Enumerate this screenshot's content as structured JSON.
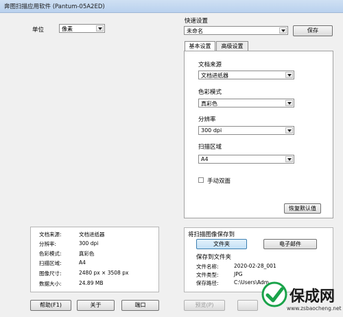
{
  "window": {
    "title": "奔图扫描应用软件 (Pantum-05A2ED)"
  },
  "unit": {
    "label": "单位",
    "value": "像素"
  },
  "quick_settings": {
    "label": "快速设置",
    "value": "未命名",
    "save_label": "保存"
  },
  "tabs": [
    {
      "label": "基本设置",
      "active": true
    },
    {
      "label": "高级设置",
      "active": false
    }
  ],
  "basic": {
    "doc_source": {
      "label": "文档来源",
      "value": "文档进纸器"
    },
    "color_mode": {
      "label": "色彩模式",
      "value": "真彩色"
    },
    "resolution": {
      "label": "分辨率",
      "value": "300 dpi"
    },
    "scan_area": {
      "label": "扫描区域",
      "value": "A4"
    },
    "duplex": {
      "label": "手动双面",
      "checked": false
    },
    "reset_label": "恢复默认值"
  },
  "summary": [
    {
      "key": "文档来源:",
      "value": "文档进纸器"
    },
    {
      "key": "分辨率:",
      "value": "300 dpi"
    },
    {
      "key": "色彩模式:",
      "value": "真彩色"
    },
    {
      "key": "扫描区域:",
      "value": "A4"
    },
    {
      "key": "图像尺寸:",
      "value": "2480 px × 3508 px"
    },
    {
      "key": "数据大小:",
      "value": "24.89 MB"
    }
  ],
  "save_to": {
    "title": "将扫描图像保存到",
    "folder_button": "文件夹",
    "email_button": "电子邮件",
    "subtitle": "保存到文件夹",
    "file_name_label": "文件名称:",
    "file_name": "2020-02-28_001",
    "file_type_label": "文件类型:",
    "file_type": "JPG",
    "save_path_label": "保存路径:",
    "save_path": "C:\\Users\\Adm..."
  },
  "buttons": {
    "help": "帮助(F1)",
    "about": "关于",
    "port": "端口",
    "preview": "预览(P)"
  },
  "watermark": {
    "text": "保成网",
    "url": "www.zsbaocheng.net",
    "brand_color": "#1aa34a"
  }
}
